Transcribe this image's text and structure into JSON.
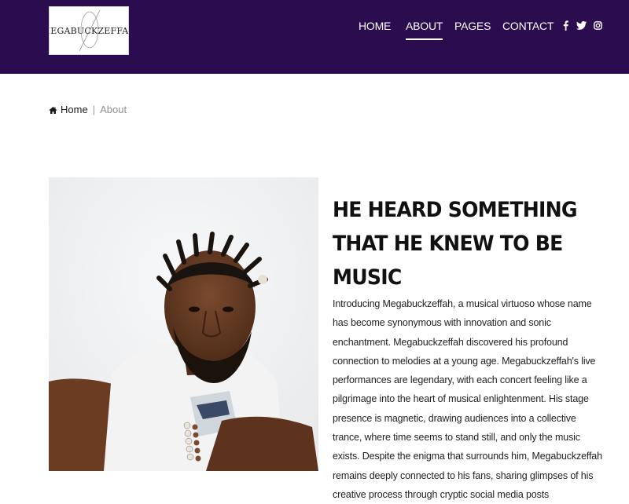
{
  "site": {
    "logo_text": "MEGABUCKZEFFAH",
    "accent": "#2b0c4e"
  },
  "nav": {
    "items": [
      {
        "label": "HOME"
      },
      {
        "label": "ABOUT",
        "active": true
      },
      {
        "label": "PAGES"
      },
      {
        "label": "CONTACT"
      }
    ],
    "social": [
      {
        "icon": "facebook-icon",
        "glyph": "f"
      },
      {
        "icon": "twitter-icon",
        "glyph": "t"
      },
      {
        "icon": "instagram-icon",
        "glyph": "i"
      }
    ]
  },
  "breadcrumb": {
    "home_label": "Home",
    "separator": "|",
    "current_label": "About"
  },
  "about": {
    "title": "HE HEARD SOMETHING THAT HE KNEW TO BE MUSIC",
    "bio": "Introducing Megabuckzeffah, a musical virtuoso whose name has become synonymous with innovation and sonic enchantment. Megabuckzeffah discovered his profound connection to melodies at a young age. Megabuckzeffah's live performances are legendary, with each concert feeling like a pilgrimage into the heart of musical enlightenment. His stage presence is magnetic, drawing audiences into a collective trance, where time seems to stand still, and only the music exists. Despite the enigma that surrounds him, Megabuckzeffah remains deeply connected to his fans, sharing glimpses of his creative process through cryptic social media posts"
  }
}
